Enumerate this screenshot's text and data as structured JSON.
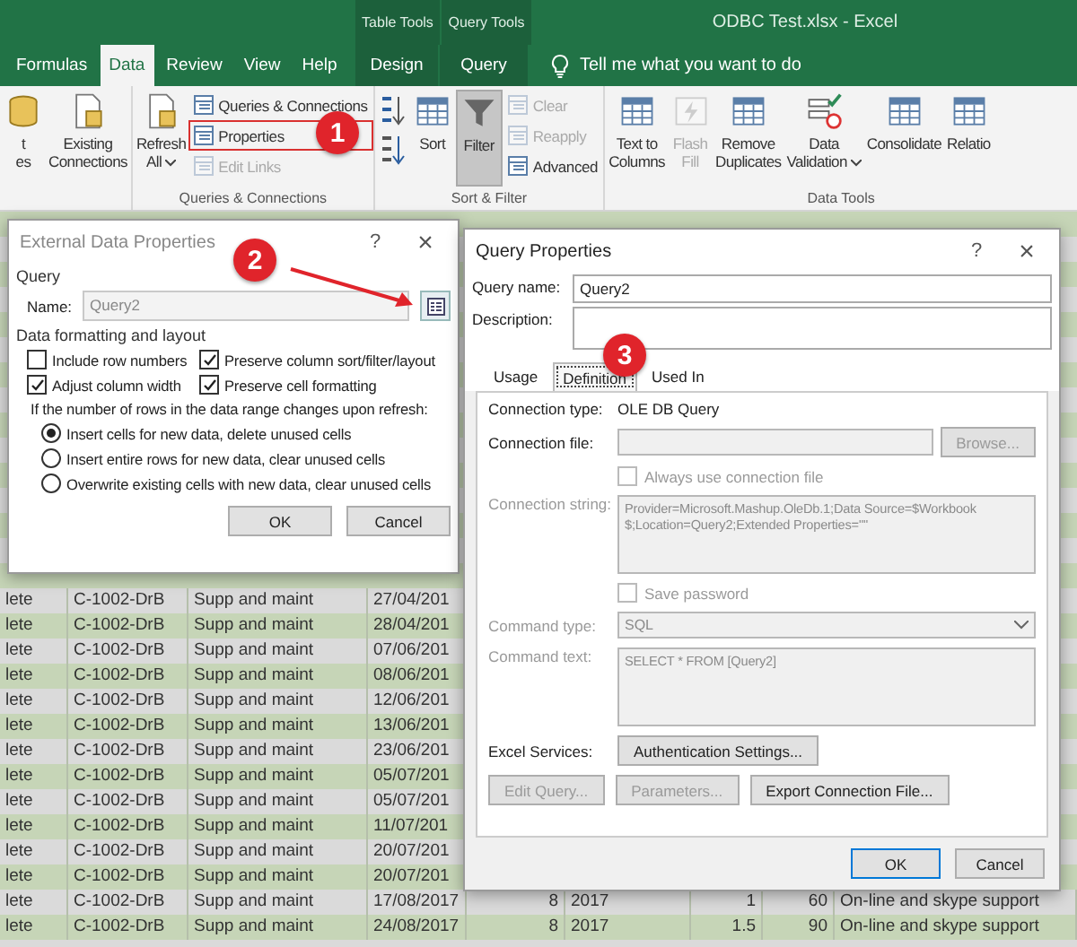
{
  "title_bar": {
    "context_tabs": [
      {
        "label": "Table Tools"
      },
      {
        "label": "Query Tools"
      }
    ],
    "title": "ODBC Test.xlsx  -  Excel"
  },
  "ribbon_tabs": [
    {
      "label": "Formulas",
      "selected": false,
      "kind": "normal"
    },
    {
      "label": "Data",
      "selected": true,
      "kind": "normal"
    },
    {
      "label": "Review",
      "selected": false,
      "kind": "normal"
    },
    {
      "label": "View",
      "selected": false,
      "kind": "normal"
    },
    {
      "label": "Help",
      "selected": false,
      "kind": "normal"
    },
    {
      "label": "Design",
      "selected": false,
      "kind": "context"
    },
    {
      "label": "Query",
      "selected": false,
      "kind": "context"
    }
  ],
  "tell_me": "Tell me what you want to do",
  "ribbon_groups": [
    {
      "columns": [
        {
          "kind": "large",
          "label": "t\nes",
          "disabled": false,
          "pressed": false,
          "dropdown": false
        },
        {
          "kind": "large",
          "label": "Existing\nConnections",
          "disabled": false,
          "pressed": false,
          "dropdown": false
        }
      ]
    },
    {
      "label": "Queries & Connections",
      "columns": [
        {
          "kind": "large",
          "label": "Refresh\nAll",
          "disabled": false,
          "pressed": false,
          "dropdown": true
        },
        {
          "kind": "stack",
          "buttons": [
            {
              "label": "Queries & Connections",
              "disabled": false,
              "highlighted": false
            },
            {
              "label": "Properties",
              "disabled": false,
              "highlighted": true
            },
            {
              "label": "Edit Links",
              "disabled": true,
              "highlighted": false
            }
          ]
        }
      ]
    },
    {
      "label": "Sort & Filter",
      "columns": [
        {
          "kind": "sort_icons"
        },
        {
          "kind": "large",
          "label": "Sort",
          "disabled": false,
          "pressed": false,
          "dropdown": false
        },
        {
          "kind": "large",
          "label": "Filter",
          "disabled": false,
          "pressed": true,
          "dropdown": false
        },
        {
          "kind": "stack",
          "buttons": [
            {
              "label": "Clear",
              "disabled": true,
              "highlighted": false
            },
            {
              "label": "Reapply",
              "disabled": true,
              "highlighted": false
            },
            {
              "label": "Advanced",
              "disabled": false,
              "highlighted": false
            }
          ]
        }
      ]
    },
    {
      "label": "Data Tools",
      "columns": [
        {
          "kind": "large",
          "label": "Text to\nColumns",
          "disabled": false,
          "pressed": false,
          "dropdown": false
        },
        {
          "kind": "large",
          "label": "Flash\nFill",
          "disabled": true,
          "pressed": false,
          "dropdown": false
        },
        {
          "kind": "large",
          "label": "Remove\nDuplicates",
          "disabled": false,
          "pressed": false,
          "dropdown": false
        },
        {
          "kind": "large",
          "label": "Data\nValidation",
          "disabled": false,
          "pressed": false,
          "dropdown": true
        },
        {
          "kind": "large",
          "label": "Consolidate",
          "disabled": false,
          "pressed": false,
          "dropdown": false
        },
        {
          "kind": "large",
          "label": "Relatio",
          "disabled": false,
          "pressed": false,
          "dropdown": false
        }
      ]
    }
  ],
  "sheet_rows": [
    {
      "cells": [
        "lete",
        "C-1002-DrB",
        "Supp and maint",
        "27/04/201"
      ]
    },
    {
      "cells": [
        "lete",
        "C-1002-DrB",
        "Supp and maint",
        "28/04/201"
      ]
    },
    {
      "cells": [
        "lete",
        "C-1002-DrB",
        "Supp and maint",
        "07/06/201"
      ]
    },
    {
      "cells": [
        "lete",
        "C-1002-DrB",
        "Supp and maint",
        "08/06/201"
      ]
    },
    {
      "cells": [
        "lete",
        "C-1002-DrB",
        "Supp and maint",
        "12/06/201"
      ]
    },
    {
      "cells": [
        "lete",
        "C-1002-DrB",
        "Supp and maint",
        "13/06/201"
      ]
    },
    {
      "cells": [
        "lete",
        "C-1002-DrB",
        "Supp and maint",
        "23/06/201"
      ]
    },
    {
      "cells": [
        "lete",
        "C-1002-DrB",
        "Supp and maint",
        "05/07/201"
      ]
    },
    {
      "cells": [
        "lete",
        "C-1002-DrB",
        "Supp and maint",
        "05/07/201"
      ]
    },
    {
      "cells": [
        "lete",
        "C-1002-DrB",
        "Supp and maint",
        "11/07/201"
      ]
    },
    {
      "cells": [
        "lete",
        "C-1002-DrB",
        "Supp and maint",
        "20/07/201"
      ]
    },
    {
      "cells": [
        "lete",
        "C-1002-DrB",
        "Supp and maint",
        "20/07/201"
      ]
    },
    {
      "cells": [
        "lete",
        "C-1002-DrB",
        "Supp and maint",
        "17/08/2017",
        "8",
        "2017",
        "1",
        "60",
        "On-line and skype support"
      ]
    },
    {
      "cells": [
        "lete",
        "C-1002-DrB",
        "Supp and maint",
        "24/08/2017",
        "8",
        "2017",
        "1.5",
        "90",
        "On-line and skype support"
      ]
    }
  ],
  "external_data_dialog": {
    "title": "External Data Properties",
    "help": "?",
    "close": "×",
    "section": "Query",
    "name_label": "Name:",
    "name_value": "Query2",
    "layout_heading": "Data formatting and layout",
    "checkboxes": [
      {
        "label": "Include row numbers",
        "checked": false
      },
      {
        "label": "Preserve column sort/filter/layout",
        "checked": true
      },
      {
        "label": "Adjust column width",
        "checked": true
      },
      {
        "label": "Preserve cell formatting",
        "checked": true
      }
    ],
    "refresh_question": "If the number of rows in the data range changes upon refresh:",
    "options": [
      {
        "label": "Insert cells for new data, delete unused cells",
        "selected": true
      },
      {
        "label": "Insert entire rows for new data, clear unused cells",
        "selected": false
      },
      {
        "label": "Overwrite existing cells with new data, clear unused cells",
        "selected": false
      }
    ],
    "buttons": [
      {
        "label": "OK"
      },
      {
        "label": "Cancel"
      }
    ]
  },
  "query_dialog": {
    "title": "Query Properties",
    "help": "?",
    "close": "×",
    "name_label": "Query name:",
    "name_value": "Query2",
    "description_label": "Description:",
    "tabs": [
      {
        "label": "Usage",
        "selected": false
      },
      {
        "label": "Definition",
        "selected": true
      },
      {
        "label": "Used In",
        "selected": false
      }
    ],
    "rows": [
      {
        "kind": "text",
        "label": "Connection type:",
        "value": "OLE DB Query",
        "disabled": false
      },
      {
        "kind": "file",
        "label": "Connection file:",
        "button": "Browse...",
        "disabled": true
      },
      {
        "kind": "checkbox",
        "label": "Always use connection file",
        "checked": false,
        "disabled": true
      },
      {
        "kind": "textarea",
        "label": "Connection string:",
        "value": "Provider=Microsoft.Mashup.OleDb.1;Data Source=$Workbook\n$;Location=Query2;Extended Properties=\"\"",
        "disabled": true
      },
      {
        "kind": "checkbox",
        "label": "Save password",
        "checked": false,
        "disabled": true
      },
      {
        "kind": "dropdown",
        "label": "Command type:",
        "value": "SQL",
        "disabled": true
      },
      {
        "kind": "textarea",
        "label": "Command text:",
        "value": "SELECT * FROM [Query2]",
        "disabled": true
      },
      {
        "kind": "button",
        "label": "Excel Services:",
        "button": "Authentication Settings...",
        "disabled": false
      }
    ],
    "actions": [
      {
        "label": "Edit Query...",
        "disabled": true
      },
      {
        "label": "Parameters...",
        "disabled": true
      },
      {
        "label": "Export Connection File...",
        "disabled": false
      }
    ],
    "buttons": [
      {
        "label": "OK",
        "default": true
      },
      {
        "label": "Cancel",
        "default": false
      }
    ]
  },
  "callouts": [
    {
      "label": "1"
    },
    {
      "label": "2"
    },
    {
      "label": "3"
    }
  ]
}
